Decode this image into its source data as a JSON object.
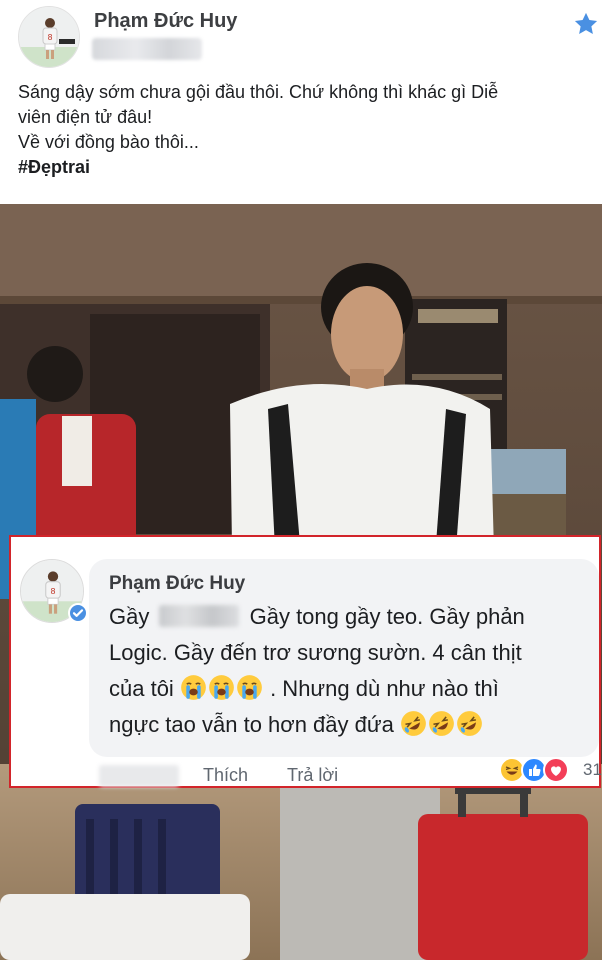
{
  "post": {
    "author": "Phạm Đức Huy",
    "text_lines": [
      "Sáng dậy sớm chưa gội đầu thôi. Chứ không thì khác gì Diễ",
      "viên điện tử đâu!",
      "Về với đồng bào thôi..."
    ],
    "hashtag": "#Đẹptrai"
  },
  "comment": {
    "author": "Phạm Đức Huy",
    "line1_start": "Gầy",
    "line1_end": "Gầy tong gầy teo. Gầy phản",
    "line2": "Logic. Gầy đến trơ sương sườn. 4 cân thịt",
    "line3_start": "của tôi",
    "line3_end": ". Nhưng dù như nào thì",
    "line4_start": "ngực tao vẫn to hơn đầy đứa",
    "actions": {
      "like": "Thích",
      "reply": "Trả lời"
    },
    "reaction_count": "31"
  },
  "colors": {
    "highlight_border": "#d2242a",
    "bubble_bg": "#f2f3f5",
    "star": "#4a90e2",
    "like_blue": "#2d88ff",
    "love_red": "#f33e58",
    "haha_yellow": "#fcc433"
  },
  "icons": {
    "star": "star-icon",
    "verified": "verified-check-icon",
    "crying_emoji": "loudly-crying-face-emoji",
    "laughing_emoji": "rolling-on-floor-laughing-emoji",
    "haha_reaction": "haha-reaction-icon",
    "like_reaction": "like-reaction-icon",
    "love_reaction": "love-reaction-icon"
  }
}
